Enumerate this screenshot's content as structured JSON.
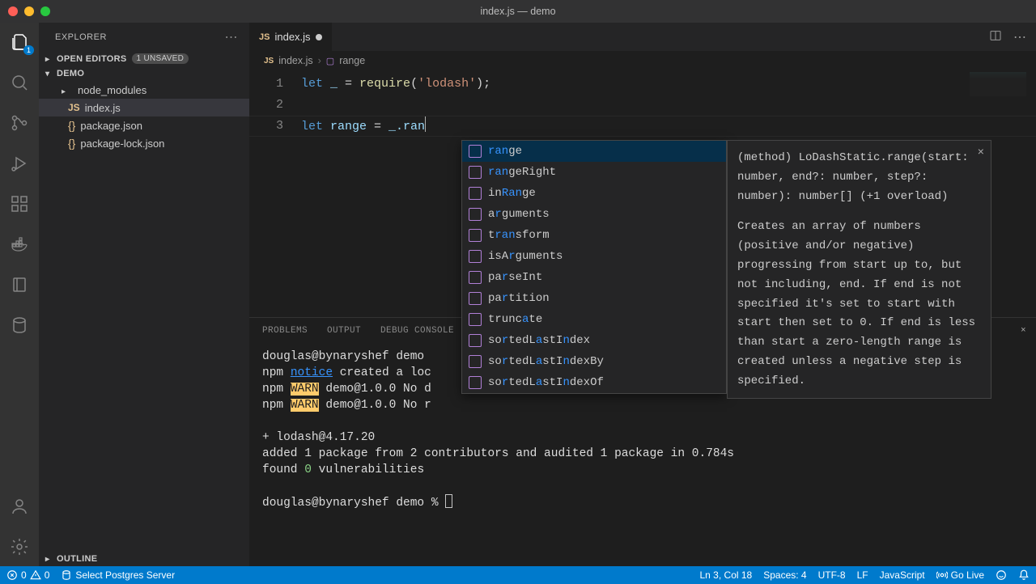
{
  "window": {
    "title": "index.js — demo"
  },
  "sidebar": {
    "title": "EXPLORER",
    "openEditors": {
      "label": "OPEN EDITORS",
      "badge": "1 UNSAVED"
    },
    "folder": "DEMO",
    "items": [
      {
        "label": "node_modules",
        "type": "folder"
      },
      {
        "label": "index.js",
        "type": "js",
        "selected": true
      },
      {
        "label": "package.json",
        "type": "json"
      },
      {
        "label": "package-lock.json",
        "type": "json"
      }
    ],
    "outline": "OUTLINE"
  },
  "activityBadge": "1",
  "tab": {
    "icon": "JS",
    "label": "index.js"
  },
  "breadcrumb": {
    "file": "index.js",
    "symbolIcon": "JS",
    "symbol": "range"
  },
  "code": {
    "lineNumbers": [
      "1",
      "2",
      "3"
    ],
    "line1_let": "let",
    "line1_var": " _ ",
    "line1_eq": "= ",
    "line1_fn": "require",
    "line1_open": "(",
    "line1_str": "'lodash'",
    "line1_close": ");",
    "line3_let": "let",
    "line3_var": " range ",
    "line3_eq": "= ",
    "line3_expr": "_.ran"
  },
  "suggest": {
    "items": [
      {
        "parts": [
          "",
          "ran",
          "ge"
        ],
        "selected": true
      },
      {
        "parts": [
          "",
          "ran",
          "geRight"
        ]
      },
      {
        "parts": [
          "in",
          "Ran",
          "ge"
        ]
      },
      {
        "parts": [
          "a",
          "r",
          "guments"
        ]
      },
      {
        "parts": [
          "t",
          "ran",
          "sform"
        ]
      },
      {
        "parts": [
          "isA",
          "r",
          "guments"
        ]
      },
      {
        "parts": [
          "pa",
          "r",
          "seInt"
        ]
      },
      {
        "parts": [
          "pa",
          "r",
          "tition"
        ]
      },
      {
        "parts": [
          "trunc",
          "a",
          "te"
        ]
      },
      {
        "parts": [
          "so",
          "r",
          "tedL",
          "a",
          "stI",
          "n",
          "dex"
        ]
      },
      {
        "parts": [
          "so",
          "r",
          "tedL",
          "a",
          "stI",
          "n",
          "dexBy"
        ]
      },
      {
        "parts": [
          "so",
          "r",
          "tedL",
          "a",
          "stI",
          "n",
          "dexOf"
        ]
      }
    ]
  },
  "doc": {
    "signature": "(method) LoDashStatic.range(start: number, end?: number, step?: number): number[] (+1 overload)",
    "body": "Creates an array of numbers (positive and/or negative) progressing from start up to, but not including, end. If end is not specified it's set to start with start then set to 0. If end is less than start a zero-length range is created unless a negative step is specified."
  },
  "panelTabs": [
    "PROBLEMS",
    "OUTPUT",
    "DEBUG CONSOLE"
  ],
  "terminal": {
    "l1_pre": "douglas@bynaryshef demo ",
    "l2_pre": "npm ",
    "l2_notice": "notice",
    "l2_post": " created a loc",
    "l3_pre": "npm ",
    "l3_warn": "WARN",
    "l3_post": " demo@1.0.0 No d",
    "l4_pre": "npm ",
    "l4_warn": "WARN",
    "l4_post": " demo@1.0.0 No r",
    "l5": "+ lodash@4.17.20",
    "l6": "added 1 package from 2 contributors and audited 1 package in 0.784s",
    "l7_pre": "found ",
    "l7_num": "0",
    "l7_post": " vulnerabilities",
    "prompt": "douglas@bynaryshef demo % "
  },
  "status": {
    "errors": "0",
    "warnings": "0",
    "postgres": "Select Postgres Server",
    "lncol": "Ln 3, Col 18",
    "spaces": "Spaces: 4",
    "enc": "UTF-8",
    "eol": "LF",
    "lang": "JavaScript",
    "live": "Go Live"
  }
}
